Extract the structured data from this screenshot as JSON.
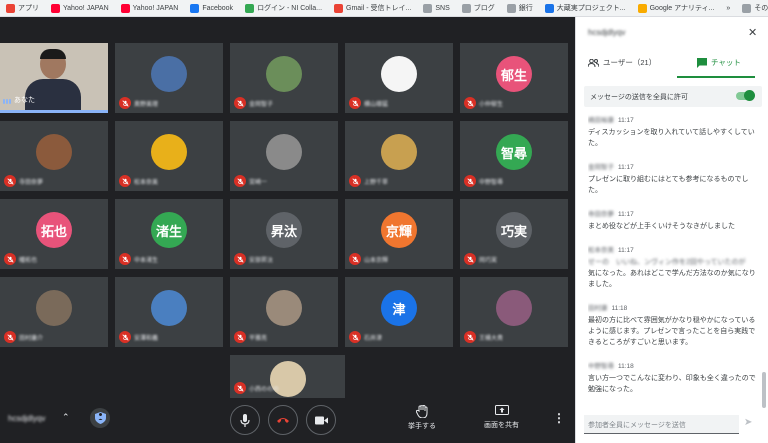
{
  "bookmarks": {
    "items": [
      {
        "label": "アプリ",
        "color": "#ea4335"
      },
      {
        "label": "Yahoo! JAPAN",
        "color": "#ff0033"
      },
      {
        "label": "Yahoo! JAPAN",
        "color": "#ff0033"
      },
      {
        "label": "Facebook",
        "color": "#1877f2"
      },
      {
        "label": "ログイン - NI Colla...",
        "color": "#34a853"
      },
      {
        "label": "Gmail - 受信トレイ...",
        "color": "#ea4335"
      },
      {
        "label": "SNS",
        "color": "#9aa0a6"
      },
      {
        "label": "ブログ",
        "color": "#9aa0a6"
      },
      {
        "label": "銀行",
        "color": "#9aa0a6"
      },
      {
        "label": "大蔵実プロジェクト...",
        "color": "#1a73e8"
      },
      {
        "label": "Google アナリティ...",
        "color": "#f9ab00"
      }
    ],
    "overflow": "»",
    "other_bookmarks": "その他のブックマーク"
  },
  "stage": {
    "self_name": "あなた",
    "participants": [
      {
        "name": "奥野美理",
        "avatar_text": "",
        "color": "#4a6fa5"
      },
      {
        "name": "金岡智子",
        "avatar_text": "",
        "color": "#6b8e5a"
      },
      {
        "name": "横山雄猛",
        "avatar_text": "",
        "color": "#f5f5f5"
      },
      {
        "name": "小仲郁生",
        "avatar_text": "郁生",
        "color": "#e8537a"
      },
      {
        "name": "寺田奈夢",
        "avatar_text": "",
        "color": "#8b5a3c"
      },
      {
        "name": "松本奈美",
        "avatar_text": "",
        "color": "#e8b01a"
      },
      {
        "name": "宮崎一",
        "avatar_text": "",
        "color": "#8a8a8a"
      },
      {
        "name": "上野千草",
        "avatar_text": "",
        "color": "#c8a050"
      },
      {
        "name": "中野智尋",
        "avatar_text": "智尋",
        "color": "#34a853"
      },
      {
        "name": "幡拓也",
        "avatar_text": "拓也",
        "color": "#e8537a"
      },
      {
        "name": "中本渚生",
        "avatar_text": "渚生",
        "color": "#34a853"
      },
      {
        "name": "安部昇汰",
        "avatar_text": "昇汰",
        "color": "#5f6368"
      },
      {
        "name": "山本京輝",
        "avatar_text": "京輝",
        "color": "#f0762f"
      },
      {
        "name": "岡巧実",
        "avatar_text": "巧実",
        "color": "#5f6368"
      },
      {
        "name": "田村康介",
        "avatar_text": "",
        "color": "#7a6a5a"
      },
      {
        "name": "安澤和義",
        "avatar_text": "",
        "color": "#4a7fc0"
      },
      {
        "name": "平雅亮",
        "avatar_text": "",
        "color": "#9a8a7a"
      },
      {
        "name": "石井津",
        "avatar_text": "津",
        "color": "#1a73e8"
      },
      {
        "name": "王桶大貴",
        "avatar_text": "",
        "color": "#8a5a7a"
      },
      {
        "name": "小西ののの",
        "avatar_text": "",
        "color": "#d8c8a8"
      }
    ]
  },
  "toolbar": {
    "meeting_code": "hcsdjdlyqv",
    "raise_hand": "挙手する",
    "present": "画面を共有"
  },
  "panel": {
    "title": "hcsdjdlyqv",
    "tab_users": "ユーザー（21）",
    "tab_chat": "チャット",
    "allow_all": "メッセージの送信を全員に許可",
    "messages": [
      {
        "sender": "嶋田裕康",
        "time": "11:17",
        "text": "ディスカッションを取り入れていて話しやすくしていた。"
      },
      {
        "sender": "金岡智子",
        "time": "11:17",
        "text": "プレゼンに取り組むにはとても参考になるものでした。"
      },
      {
        "sender": "寺田奈夢",
        "time": "11:17",
        "text": "まとめ役などが上手くいけそうなきがしました"
      },
      {
        "sender": "松本奈美",
        "time": "11:17",
        "text": "なども以前の...",
        "blurred": "せーの　いいね、ンヴィン作を2回やっていたのが",
        "text2": "気になった。あれはどこで学んだ方法なのか気になりました。"
      },
      {
        "sender": "田村康",
        "time": "11:18",
        "text": "最初の方に比べて雰囲気がかなり穏やかになっているように感じます。プレゼンで言ったことを自ら実践できるところがすごいと思います。"
      },
      {
        "sender": "中野智尋",
        "time": "11:18",
        "text": "言い方一つでこんなに変わり、印象も全く違ったので勉強になった。"
      }
    ],
    "input_placeholder": "参加者全員にメッセージを送信"
  },
  "colors": {
    "accent": "#1e8e3e",
    "end_call": "#ea4335",
    "muted": "#d93025",
    "stage_bg": "#202124",
    "tile_bg": "#3c4043"
  }
}
